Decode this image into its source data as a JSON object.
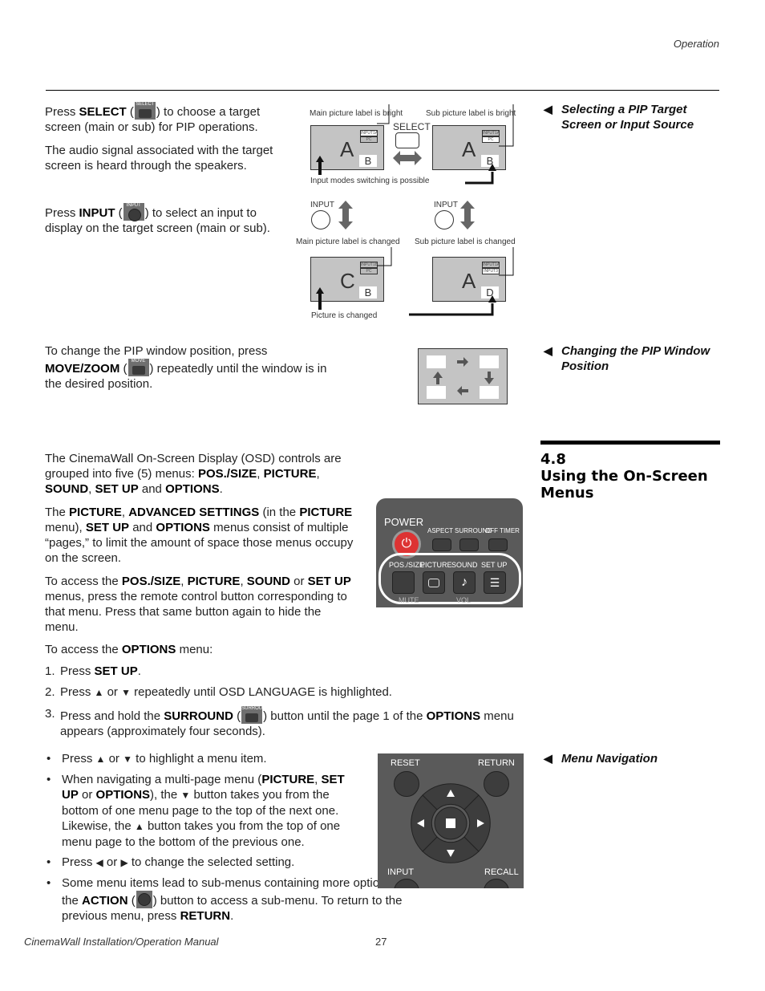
{
  "header": {
    "section": "Operation"
  },
  "pip_select": {
    "para1": {
      "pre": "Press ",
      "bold": "SELECT",
      "open": " (",
      "close": ") to choose a target screen (main or sub) for PIP operations.",
      "icon_label": "SELECT"
    },
    "para2": "The audio signal associated with the target screen is heard through the speakers.",
    "para3": {
      "pre": "Press ",
      "bold": "INPUT",
      "open": " (",
      "close": ") to select an input to display on the target screen (main or sub).",
      "icon_label": "INPUT"
    },
    "side_heading_line1": "Selecting a PIP Target",
    "side_heading_line2": "Screen or Input Source",
    "diagram": {
      "main_bright": "Main picture label is bright",
      "sub_bright": "Sub picture label is bright",
      "select_label": "SELECT",
      "switching": "Input modes switching is possible",
      "input_label": "INPUT",
      "main_changed": "Main picture label is changed",
      "sub_changed": "Sub picture label is changed",
      "picture_changed": "Picture is changed",
      "screens": [
        {
          "main": "A",
          "sub": "B",
          "tag1": "INPUT1A",
          "tag2": "PC"
        },
        {
          "main": "A",
          "sub": "B",
          "tag1": "INPUT1A",
          "tag2": "PC"
        },
        {
          "main": "C",
          "sub": "B",
          "tag1": "INPUT1B",
          "tag2": "PC"
        },
        {
          "main": "A",
          "sub": "D",
          "tag1": "INPUT1A",
          "tag2": "INPUT3"
        }
      ]
    }
  },
  "pip_position": {
    "line1": "To change the PIP window position, press",
    "bold": "MOVE/ZOOM",
    "open": " (",
    "close": ") repeatedly until the window is in",
    "line3": "the desired position.",
    "icon_label": "MOVE",
    "side_heading_line1": "Changing the PIP Window",
    "side_heading_line2": "Position"
  },
  "section": {
    "number": "4.8",
    "title_line1": "Using the On-Screen",
    "title_line2": "Menus"
  },
  "osd": {
    "p1": [
      {
        "t": "The CinemaWall On-Screen Display (OSD) controls are grouped into five (5) menus: "
      },
      {
        "b": "POS./SIZE"
      },
      {
        "t": ", "
      },
      {
        "b": "PICTURE"
      },
      {
        "t": ", "
      },
      {
        "b": "SOUND"
      },
      {
        "t": ", "
      },
      {
        "b": "SET UP"
      },
      {
        "t": " and "
      },
      {
        "b": "OPTIONS"
      },
      {
        "t": "."
      }
    ],
    "p2": [
      {
        "t": "The "
      },
      {
        "b": "PICTURE"
      },
      {
        "t": ", "
      },
      {
        "b": "ADVANCED SETTINGS"
      },
      {
        "t": " (in the "
      },
      {
        "b": "PICTURE"
      },
      {
        "t": " menu), "
      },
      {
        "b": "SET UP"
      },
      {
        "t": " and "
      },
      {
        "b": "OPTIONS"
      },
      {
        "t": " menus consist of multiple “pages,” to limit the amount of space those menus occupy on the screen."
      }
    ],
    "p3": [
      {
        "t": "To access the "
      },
      {
        "b": "POS./SIZE"
      },
      {
        "t": ", "
      },
      {
        "b": "PICTURE"
      },
      {
        "t": ", "
      },
      {
        "b": "SOUND"
      },
      {
        "t": " or "
      },
      {
        "b": "SET UP"
      },
      {
        "t": " menus, press the remote control button corresponding to that menu. Press that same button again to hide the menu."
      }
    ],
    "p4": [
      {
        "t": "To access the "
      },
      {
        "b": "OPTIONS"
      },
      {
        "t": " menu:"
      }
    ],
    "steps": [
      {
        "num": "1.",
        "parts": [
          {
            "t": "Press "
          },
          {
            "b": "SET UP"
          },
          {
            "t": "."
          }
        ]
      },
      {
        "num": "2.",
        "parts": [
          {
            "t": "Press "
          },
          {
            "i": "up"
          },
          {
            "t": " or "
          },
          {
            "i": "down"
          },
          {
            "t": " repeatedly until OSD LANGUAGE is highlighted."
          }
        ]
      },
      {
        "num": "3.",
        "parts": [
          {
            "t": "Press and hold the "
          },
          {
            "b": "SURROUND"
          },
          {
            "t": " ("
          },
          {
            "icon": "SURROUND"
          },
          {
            "t": ") button until the page 1 of the "
          },
          {
            "b": "OPTIONS"
          },
          {
            "t": " menu appears (approximately four seconds)."
          }
        ]
      }
    ],
    "remote": {
      "power": "POWER",
      "aspect": "ASPECT",
      "surround": "SURROUND",
      "off_timer": "OFF TIMER",
      "pos_size": "POS./SIZE",
      "picture": "PICTURE",
      "sound": "SOUND",
      "set_up": "SET UP",
      "mute": "MUTE",
      "vol": "VOL"
    }
  },
  "nav": {
    "side_heading": "Menu Navigation",
    "bullets": [
      [
        {
          "t": "Press "
        },
        {
          "i": "up"
        },
        {
          "t": " or "
        },
        {
          "i": "down"
        },
        {
          "t": " to highlight a menu item."
        }
      ],
      [
        {
          "t": "When navigating a multi-page menu ("
        },
        {
          "b": "PICTURE"
        },
        {
          "t": ", "
        },
        {
          "b": "SET UP"
        },
        {
          "t": " or "
        },
        {
          "b": "OPTIONS"
        },
        {
          "t": "), the "
        },
        {
          "i": "down"
        },
        {
          "t": " button takes you from the bottom of one menu page to the top of the next one. Likewise, the "
        },
        {
          "i": "up"
        },
        {
          "t": " button takes you from the top of one menu page to the bottom of the previous one."
        }
      ],
      [
        {
          "t": "Press "
        },
        {
          "i": "left"
        },
        {
          "t": " or "
        },
        {
          "i": "right"
        },
        {
          "t": " to change the selected setting."
        }
      ],
      [
        {
          "t": "Some menu items lead to sub-menus containing more options. Press the "
        },
        {
          "b": "ACTION"
        },
        {
          "t": " ("
        },
        {
          "icon": "ACTION"
        },
        {
          "t": ") button to access a sub-menu. To return to the previous menu, press "
        },
        {
          "b": "RETURN"
        },
        {
          "t": "."
        }
      ]
    ],
    "remote": {
      "reset": "RESET",
      "return": "RETURN",
      "input": "INPUT",
      "recall": "RECALL"
    }
  },
  "footer": {
    "manual": "CinemaWall Installation/Operation Manual",
    "page": "27"
  }
}
